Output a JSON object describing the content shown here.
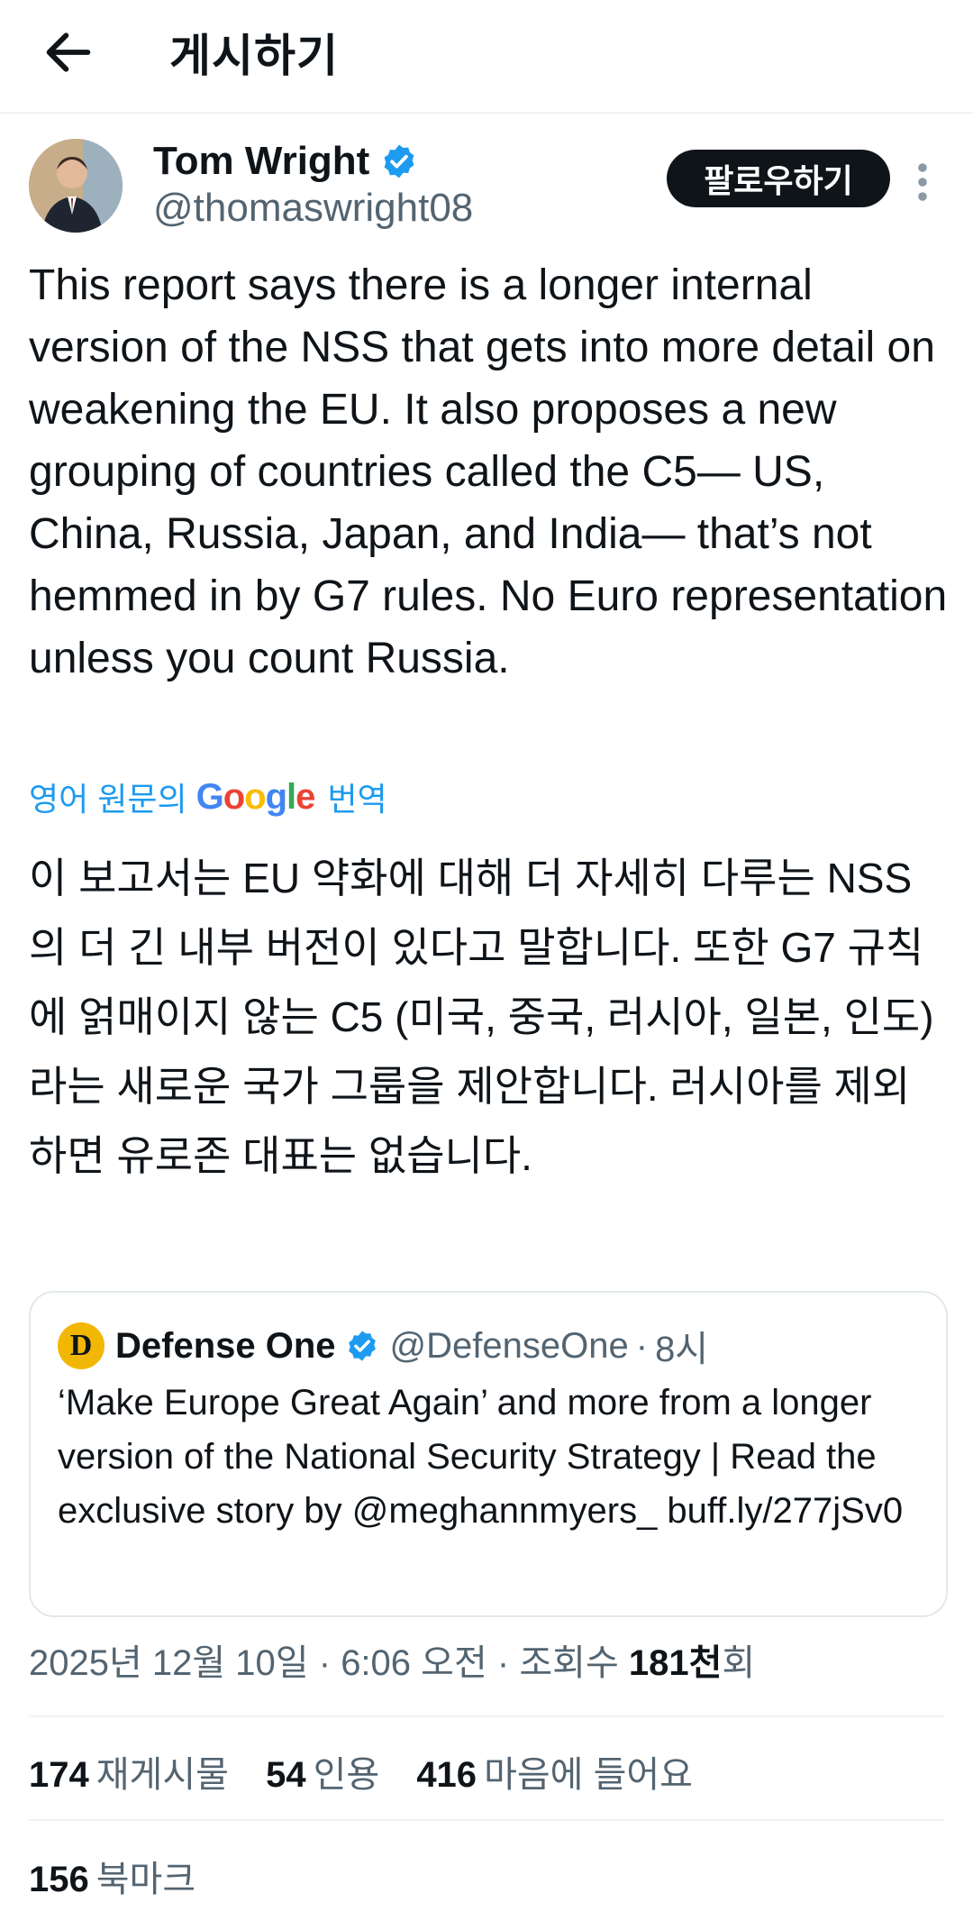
{
  "header": {
    "title": "게시하기"
  },
  "author": {
    "name": "Tom Wright",
    "handle": "@thomaswright08",
    "follow_label": "팔로우하기"
  },
  "tweet": {
    "text": "This report says there is a longer internal version of the NSS that gets into more detail on weakening the EU. It also proposes a new grouping of countries called the C5— US, China, Russia, Japan, and India— that’s not hemmed in by G7 rules. No Euro representation unless you count Russia.",
    "translate_prefix": "영어 원문의",
    "translate_brand": "Google",
    "translate_suffix": "번역",
    "translated_text": "이 보고서는 EU 약화에 대해 더 자세히 다루는 NSS의 더 긴 내부 버전이 있다고 말합니다. 또한 G7 규칙에 얽매이지 않는 C5 (미국, 중국, 러시아, 일본, 인도)라는 새로운 국가 그룹을 제안합니다. 러시아를 제외하면 유로존 대표는 없습니다."
  },
  "quote": {
    "avatar_letter": "D",
    "name": "Defense One",
    "handle": "@DefenseOne",
    "separator": "·",
    "time": "8시",
    "text": "‘Make Europe Great Again’ and more from a longer version of the National Security Strategy |  Read the exclusive story by @meghannmyers_ buff.ly/277jSv0"
  },
  "meta": {
    "date": "2025년 12월 10일",
    "separator": "·",
    "time": "6:06 오전",
    "views_prefix": "조회수",
    "views_count": "181천",
    "views_suffix": "회"
  },
  "stats": {
    "reposts": "174",
    "reposts_label": "재게시물",
    "quotes": "54",
    "quotes_label": "인용",
    "likes": "416",
    "likes_label": "마음에 들어요",
    "bookmarks": "156",
    "bookmarks_label": "북마크"
  },
  "colors": {
    "accent": "#1d9bf0",
    "text": "#0f1419",
    "muted": "#536471",
    "border": "#e1e8ed",
    "defense_one_avatar": "#f2b705"
  },
  "icons": {
    "back": "arrow-left-icon",
    "verified": "verified-badge-icon",
    "more": "more-vertical-icon"
  }
}
